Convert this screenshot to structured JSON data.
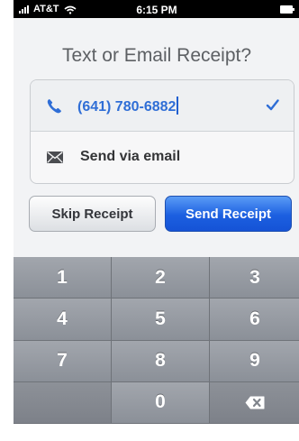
{
  "status_bar": {
    "carrier": "AT&T",
    "time": "6:15 PM",
    "icons": [
      "signal-icon",
      "wifi-icon",
      "battery-icon"
    ]
  },
  "receipt": {
    "title": "Text or Email Receipt?",
    "phone_value": "(641) 780-6882",
    "email_label": "Send via email",
    "icons": [
      "phone-icon",
      "check-icon",
      "mail-icon"
    ]
  },
  "buttons": {
    "skip_label": "Skip Receipt",
    "send_label": "Send Receipt"
  },
  "keypad": {
    "keys": [
      "1",
      "2",
      "3",
      "4",
      "5",
      "6",
      "7",
      "8",
      "9",
      "",
      "0",
      "delete-icon"
    ]
  },
  "colors": {
    "accent": "#2f6ed6",
    "send_button": "#1c5fe0",
    "keypad": "#8b9098"
  }
}
